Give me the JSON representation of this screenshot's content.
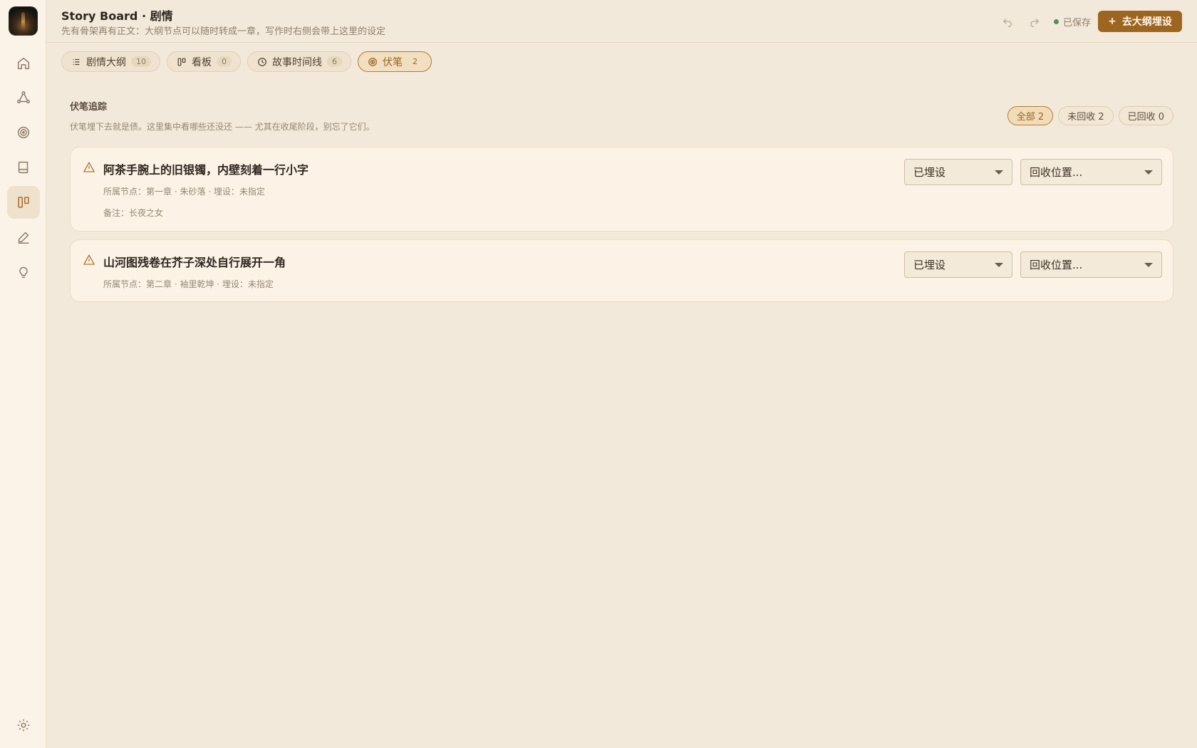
{
  "app": {
    "title": "Story Board · 剧情",
    "subtitle": "先有骨架再有正文：大纲节点可以随时转成一章，写作时右侧会带上这里的设定"
  },
  "sidebar": {
    "items": [
      {
        "icon": "home-icon"
      },
      {
        "icon": "graph-icon"
      },
      {
        "icon": "target-icon"
      },
      {
        "icon": "book-icon"
      },
      {
        "icon": "board-icon",
        "active": true
      },
      {
        "icon": "pen-icon"
      },
      {
        "icon": "lightbulb-icon"
      }
    ],
    "settings_icon": "gear-icon"
  },
  "header": {
    "saved_label": "已保存",
    "primary_button": "去大纲埋设",
    "primary_plus": "+"
  },
  "tabs": [
    {
      "label": "剧情大纲",
      "count": "10",
      "icon": "list-icon"
    },
    {
      "label": "看板",
      "count": "0",
      "icon": "board-icon"
    },
    {
      "label": "故事时间线",
      "count": "6",
      "icon": "clock-icon"
    },
    {
      "label": "伏笔",
      "count": "2",
      "icon": "target-icon",
      "active": true
    }
  ],
  "section": {
    "title": "伏笔追踪",
    "description": "伏笔埋下去就是债。这里集中看哪些还没还 —— 尤其在收尾阶段，别忘了它们。"
  },
  "filters": [
    {
      "label": "全部 2",
      "active": true
    },
    {
      "label": "未回收 2"
    },
    {
      "label": "已回收 0"
    }
  ],
  "foreshadows": [
    {
      "title": "阿茶手腕上的旧银镯，内壁刻着一行小字",
      "meta": "所属节点：第一章 · 朱砂落 · 埋设：未指定",
      "note": "备注：长夜之女",
      "status": "已埋设",
      "recall_placeholder": "回收位置..."
    },
    {
      "title": "山河图残卷在芥子深处自行展开一角",
      "meta": "所属节点：第二章 · 袖里乾坤 · 埋设：未指定",
      "status": "已埋设",
      "recall_placeholder": "回收位置..."
    }
  ],
  "colors": {
    "accent": "#9c6620",
    "background": "#f3e9da",
    "sidebar": "#fbf3e7",
    "card": "#fcf3e6",
    "saved_dot": "#4e8f5a"
  }
}
